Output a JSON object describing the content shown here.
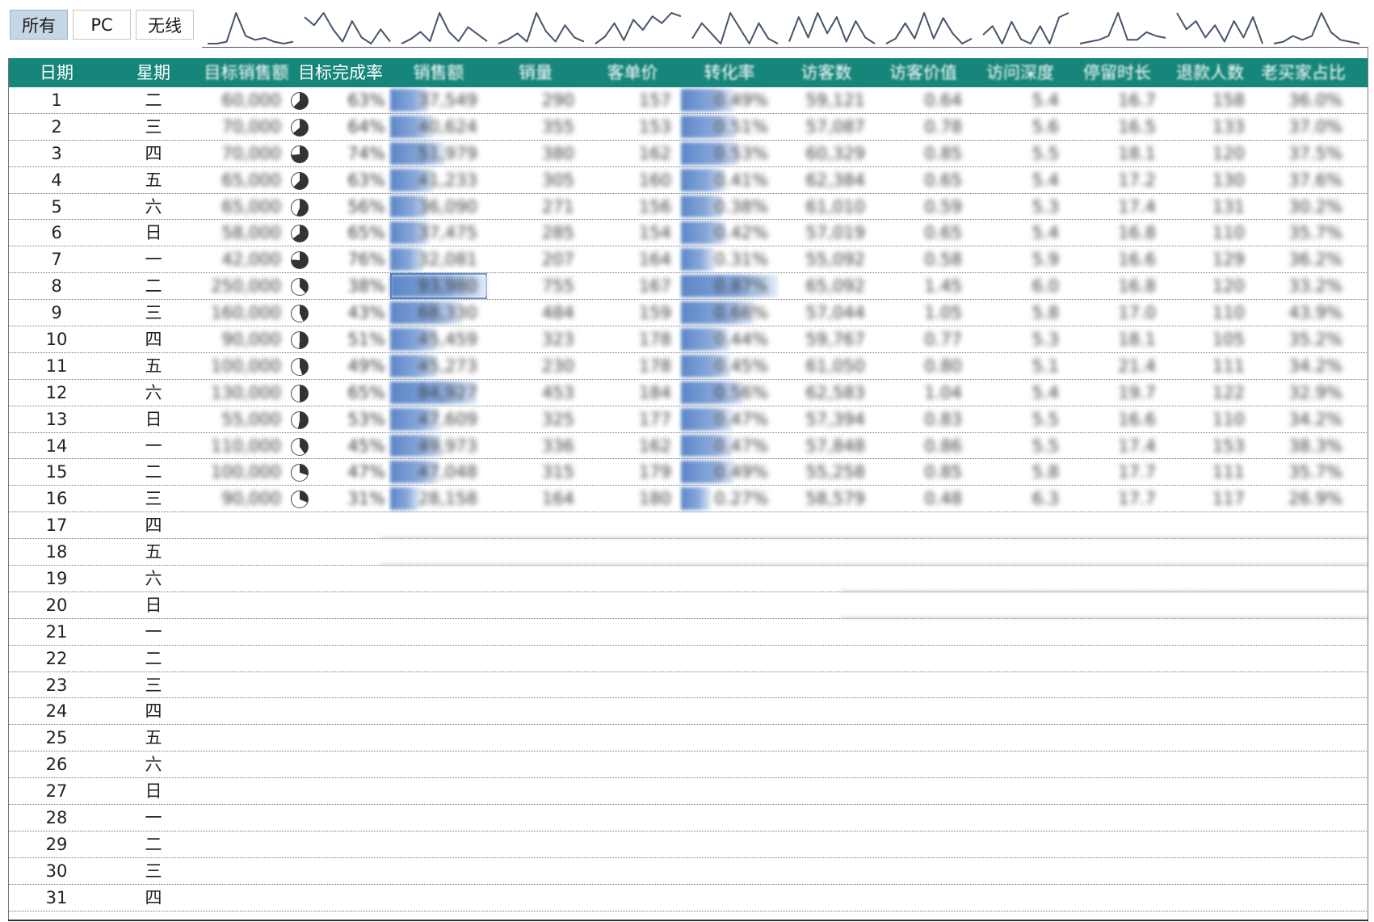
{
  "tabs": [
    {
      "label": "所有",
      "active": true
    },
    {
      "label": "PC",
      "active": false
    },
    {
      "label": "无线",
      "active": false
    }
  ],
  "columns": [
    "日期",
    "星期",
    "目标销售额",
    "目标完成率",
    "销售额",
    "销量",
    "客单价",
    "转化率",
    "访客数",
    "访客价值",
    "访问深度",
    "停留时长",
    "退款人数",
    "老买家占比"
  ],
  "colors": {
    "header_bg": "#17867a",
    "header_text": "#ffffff",
    "databar": "#5b86c7",
    "sparkline": "#44546a",
    "active_tab": "#c6d6e4"
  },
  "rows": [
    {
      "date": "1",
      "weekday": "二",
      "target": "60,000",
      "completion": "63%",
      "comp_frac": 0.63,
      "sales": "37,549",
      "sales_frac": 0.4,
      "qty": "290",
      "price": "157",
      "conv": "0.49%",
      "conv_frac": 0.55,
      "visits": "59,121",
      "value": "0.64",
      "depth": "5.4",
      "stay": "16.7",
      "refund": "158",
      "old": "36.0%"
    },
    {
      "date": "2",
      "weekday": "三",
      "target": "70,000",
      "completion": "64%",
      "comp_frac": 0.64,
      "sales": "40,624",
      "sales_frac": 0.44,
      "qty": "355",
      "price": "153",
      "conv": "0.51%",
      "conv_frac": 0.57,
      "visits": "57,087",
      "value": "0.78",
      "depth": "5.6",
      "stay": "16.5",
      "refund": "133",
      "old": "37.0%"
    },
    {
      "date": "3",
      "weekday": "四",
      "target": "70,000",
      "completion": "74%",
      "comp_frac": 0.74,
      "sales": "51,979",
      "sales_frac": 0.56,
      "qty": "380",
      "price": "162",
      "conv": "0.53%",
      "conv_frac": 0.6,
      "visits": "60,329",
      "value": "0.85",
      "depth": "5.5",
      "stay": "18.1",
      "refund": "120",
      "old": "37.5%"
    },
    {
      "date": "4",
      "weekday": "五",
      "target": "65,000",
      "completion": "63%",
      "comp_frac": 0.63,
      "sales": "41,233",
      "sales_frac": 0.45,
      "qty": "305",
      "price": "160",
      "conv": "0.41%",
      "conv_frac": 0.46,
      "visits": "62,384",
      "value": "0.65",
      "depth": "5.4",
      "stay": "17.2",
      "refund": "130",
      "old": "37.6%"
    },
    {
      "date": "5",
      "weekday": "六",
      "target": "65,000",
      "completion": "56%",
      "comp_frac": 0.56,
      "sales": "36,090",
      "sales_frac": 0.39,
      "qty": "271",
      "price": "156",
      "conv": "0.38%",
      "conv_frac": 0.43,
      "visits": "61,010",
      "value": "0.59",
      "depth": "5.3",
      "stay": "17.4",
      "refund": "131",
      "old": "30.2%"
    },
    {
      "date": "6",
      "weekday": "日",
      "target": "58,000",
      "completion": "65%",
      "comp_frac": 0.65,
      "sales": "37,475",
      "sales_frac": 0.4,
      "qty": "285",
      "price": "154",
      "conv": "0.42%",
      "conv_frac": 0.47,
      "visits": "57,019",
      "value": "0.65",
      "depth": "5.4",
      "stay": "16.8",
      "refund": "110",
      "old": "35.7%"
    },
    {
      "date": "7",
      "weekday": "一",
      "target": "42,000",
      "completion": "76%",
      "comp_frac": 0.76,
      "sales": "32,081",
      "sales_frac": 0.34,
      "qty": "207",
      "price": "164",
      "conv": "0.31%",
      "conv_frac": 0.35,
      "visits": "55,092",
      "value": "0.58",
      "depth": "5.9",
      "stay": "16.6",
      "refund": "129",
      "old": "36.2%"
    },
    {
      "date": "8",
      "weekday": "二",
      "target": "250,000",
      "completion": "38%",
      "comp_frac": 0.38,
      "sales": "93,980",
      "sales_frac": 1.0,
      "qty": "755",
      "price": "167",
      "conv": "0.87%",
      "conv_frac": 1.0,
      "visits": "65,092",
      "value": "1.45",
      "depth": "6.0",
      "stay": "16.8",
      "refund": "120",
      "old": "33.2%",
      "selected": true
    },
    {
      "date": "9",
      "weekday": "三",
      "target": "160,000",
      "completion": "43%",
      "comp_frac": 0.43,
      "sales": "68,330",
      "sales_frac": 0.73,
      "qty": "484",
      "price": "159",
      "conv": "0.66%",
      "conv_frac": 0.76,
      "visits": "57,044",
      "value": "1.05",
      "depth": "5.8",
      "stay": "17.0",
      "refund": "110",
      "old": "43.9%"
    },
    {
      "date": "10",
      "weekday": "四",
      "target": "90,000",
      "completion": "51%",
      "comp_frac": 0.51,
      "sales": "45,459",
      "sales_frac": 0.48,
      "qty": "323",
      "price": "178",
      "conv": "0.44%",
      "conv_frac": 0.5,
      "visits": "59,767",
      "value": "0.77",
      "depth": "5.3",
      "stay": "18.1",
      "refund": "105",
      "old": "35.2%"
    },
    {
      "date": "11",
      "weekday": "五",
      "target": "100,000",
      "completion": "49%",
      "comp_frac": 0.45,
      "sales": "45,273",
      "sales_frac": 0.48,
      "qty": "230",
      "price": "178",
      "conv": "0.45%",
      "conv_frac": 0.51,
      "visits": "61,050",
      "value": "0.80",
      "depth": "5.1",
      "stay": "21.4",
      "refund": "111",
      "old": "34.2%"
    },
    {
      "date": "12",
      "weekday": "六",
      "target": "130,000",
      "completion": "65%",
      "comp_frac": 0.5,
      "sales": "84,927",
      "sales_frac": 0.9,
      "qty": "453",
      "price": "184",
      "conv": "0.56%",
      "conv_frac": 0.64,
      "visits": "62,583",
      "value": "1.04",
      "depth": "5.4",
      "stay": "19.7",
      "refund": "122",
      "old": "32.9%"
    },
    {
      "date": "13",
      "weekday": "日",
      "target": "55,000",
      "completion": "53%",
      "comp_frac": 0.53,
      "sales": "47,609",
      "sales_frac": 0.51,
      "qty": "325",
      "price": "177",
      "conv": "0.47%",
      "conv_frac": 0.53,
      "visits": "57,394",
      "value": "0.83",
      "depth": "5.5",
      "stay": "16.6",
      "refund": "110",
      "old": "34.2%"
    },
    {
      "date": "14",
      "weekday": "一",
      "target": "110,000",
      "completion": "45%",
      "comp_frac": 0.4,
      "sales": "49,973",
      "sales_frac": 0.53,
      "qty": "336",
      "price": "162",
      "conv": "0.47%",
      "conv_frac": 0.53,
      "visits": "57,848",
      "value": "0.86",
      "depth": "5.5",
      "stay": "17.4",
      "refund": "153",
      "old": "38.3%"
    },
    {
      "date": "15",
      "weekday": "二",
      "target": "100,000",
      "completion": "47%",
      "comp_frac": 0.3,
      "sales": "47,048",
      "sales_frac": 0.5,
      "qty": "315",
      "price": "179",
      "conv": "0.49%",
      "conv_frac": 0.55,
      "visits": "55,258",
      "value": "0.85",
      "depth": "5.8",
      "stay": "17.7",
      "refund": "111",
      "old": "35.7%"
    },
    {
      "date": "16",
      "weekday": "三",
      "target": "90,000",
      "completion": "31%",
      "comp_frac": 0.31,
      "sales": "28,158",
      "sales_frac": 0.3,
      "qty": "164",
      "price": "180",
      "conv": "0.27%",
      "conv_frac": 0.31,
      "visits": "58,579",
      "value": "0.48",
      "depth": "6.3",
      "stay": "17.7",
      "refund": "117",
      "old": "26.9%"
    },
    {
      "date": "17",
      "weekday": "四"
    },
    {
      "date": "18",
      "weekday": "五"
    },
    {
      "date": "19",
      "weekday": "六"
    },
    {
      "date": "20",
      "weekday": "日"
    },
    {
      "date": "21",
      "weekday": "一"
    },
    {
      "date": "22",
      "weekday": "二"
    },
    {
      "date": "23",
      "weekday": "三"
    },
    {
      "date": "24",
      "weekday": "四"
    },
    {
      "date": "25",
      "weekday": "五"
    },
    {
      "date": "26",
      "weekday": "六"
    },
    {
      "date": "27",
      "weekday": "日"
    },
    {
      "date": "28",
      "weekday": "一"
    },
    {
      "date": "29",
      "weekday": "二"
    },
    {
      "date": "30",
      "weekday": "三"
    },
    {
      "date": "31",
      "weekday": "四"
    }
  ],
  "sparklines": [
    [
      2,
      2,
      3,
      18,
      6,
      4,
      5,
      3,
      2,
      3
    ],
    [
      16,
      12,
      18,
      10,
      4,
      14,
      6,
      3,
      10,
      4
    ],
    [
      3,
      5,
      8,
      4,
      16,
      8,
      4,
      10,
      7,
      4
    ],
    [
      3,
      5,
      8,
      4,
      18,
      9,
      4,
      12,
      6,
      4
    ],
    [
      2,
      6,
      14,
      4,
      16,
      10,
      18,
      14,
      20,
      18
    ],
    [
      6,
      12,
      8,
      4,
      16,
      10,
      4,
      12,
      6,
      4
    ],
    [
      4,
      16,
      6,
      18,
      8,
      16,
      4,
      14,
      6,
      3
    ],
    [
      4,
      6,
      12,
      6,
      16,
      6,
      14,
      8,
      4,
      6
    ],
    [
      8,
      12,
      4,
      14,
      6,
      4,
      12,
      4,
      16,
      18
    ],
    [
      2,
      3,
      4,
      6,
      18,
      4,
      4,
      8,
      6,
      5
    ],
    [
      18,
      10,
      14,
      6,
      12,
      4,
      14,
      6,
      16,
      3
    ],
    [
      2,
      3,
      6,
      4,
      6,
      18,
      8,
      4,
      3,
      2
    ]
  ]
}
